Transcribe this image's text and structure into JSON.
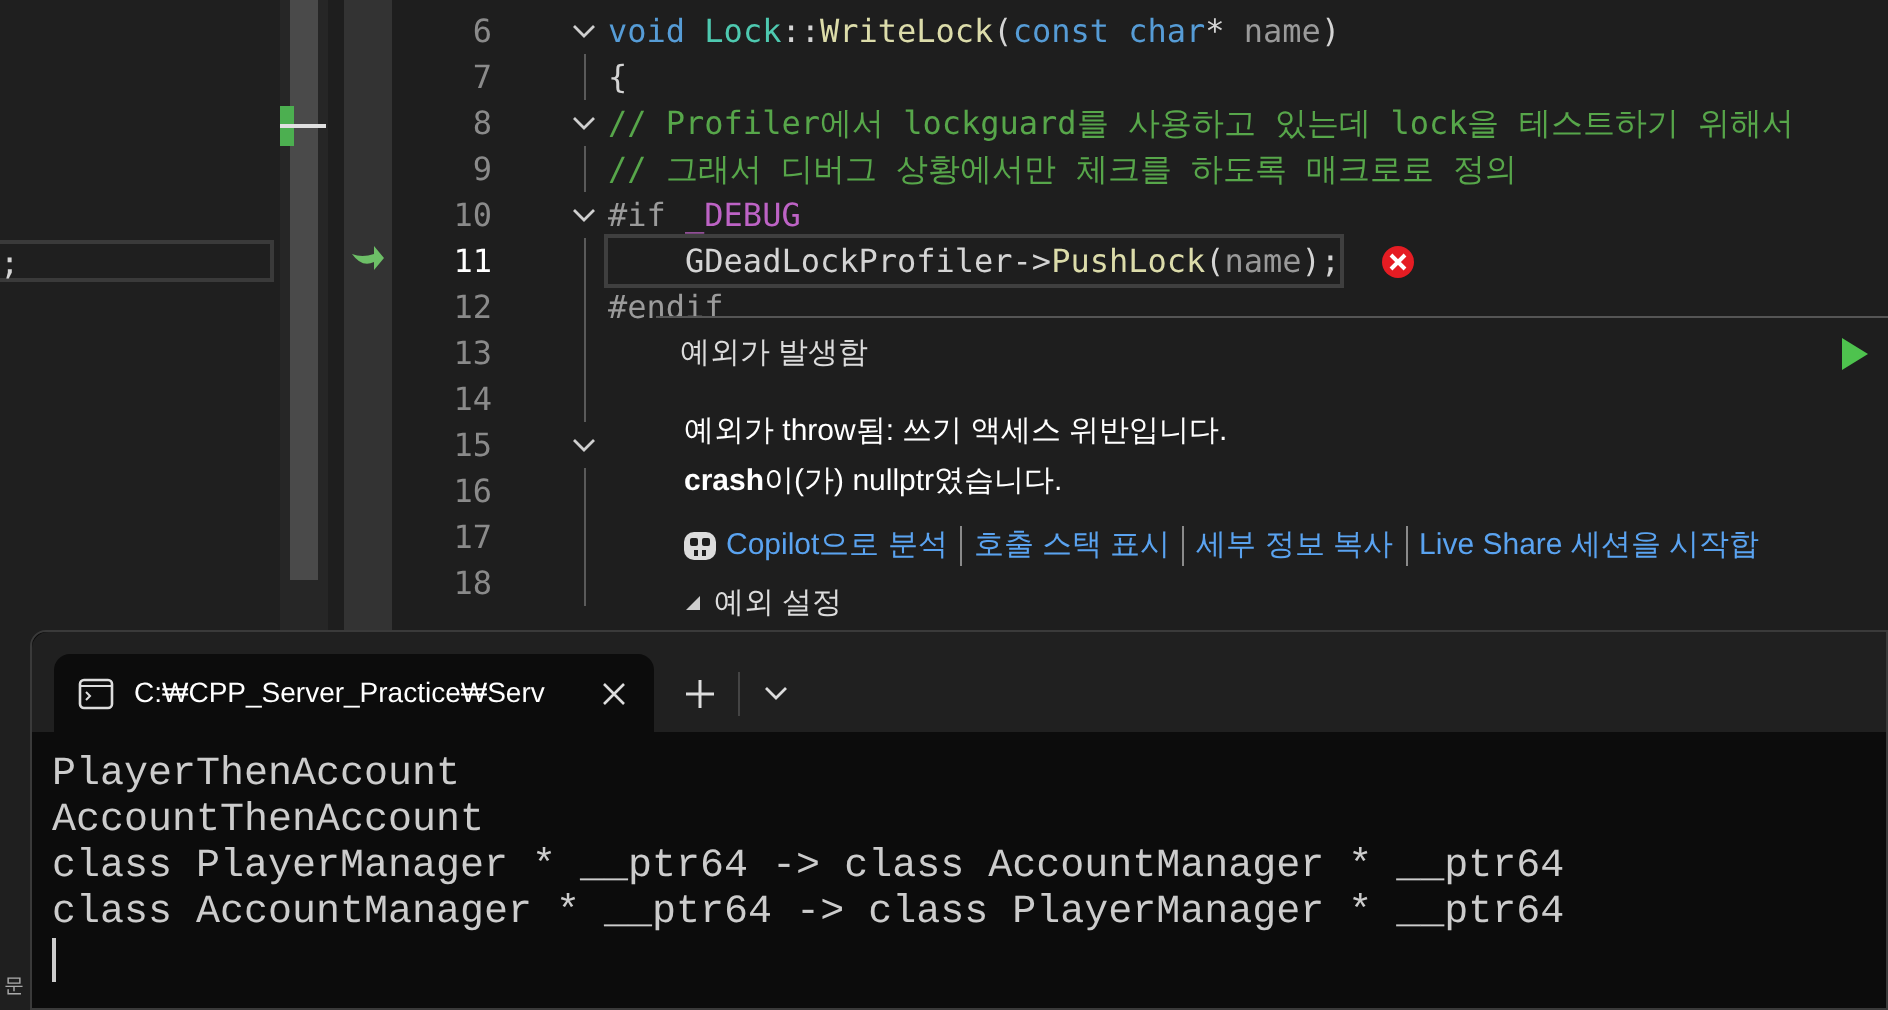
{
  "left_panel": {
    "text": ";"
  },
  "editor": {
    "lines": [
      {
        "number": "6",
        "fold": true,
        "current": false,
        "tokens": [
          {
            "kind": "kw",
            "text": "void "
          },
          {
            "kind": "type",
            "text": "Lock"
          },
          {
            "kind": "plain",
            "text": "::"
          },
          {
            "kind": "fn",
            "text": "WriteLock"
          },
          {
            "kind": "plain",
            "text": "("
          },
          {
            "kind": "kw",
            "text": "const char"
          },
          {
            "kind": "plain",
            "text": "* "
          },
          {
            "kind": "param",
            "text": "name"
          },
          {
            "kind": "plain",
            "text": ")"
          }
        ]
      },
      {
        "number": "7",
        "fold": false,
        "current": false,
        "tokens": [
          {
            "kind": "plain",
            "text": "{"
          }
        ]
      },
      {
        "number": "8",
        "fold": true,
        "current": false,
        "tokens": [
          {
            "kind": "comment",
            "text": "// Profiler에서 lockguard를 사용하고 있는데 lock을 테스트하기 위해서"
          }
        ]
      },
      {
        "number": "9",
        "fold": false,
        "current": false,
        "tokens": [
          {
            "kind": "comment",
            "text": "// 그래서 디버그 상황에서만 체크를 하도록 매크로로 정의"
          }
        ]
      },
      {
        "number": "10",
        "fold": true,
        "current": false,
        "tokens": [
          {
            "kind": "pre",
            "text": "#if "
          },
          {
            "kind": "macro",
            "text": "_DEBUG"
          }
        ]
      },
      {
        "number": "11",
        "fold": false,
        "current": true,
        "error": true,
        "tokens": [
          {
            "kind": "plain",
            "text": "    GDeadLockProfiler->"
          },
          {
            "kind": "fn",
            "text": "PushLock"
          },
          {
            "kind": "plain",
            "text": "("
          },
          {
            "kind": "param",
            "text": "name"
          },
          {
            "kind": "plain",
            "text": ");"
          }
        ]
      },
      {
        "number": "12",
        "fold": false,
        "current": false,
        "tokens": [
          {
            "kind": "pre",
            "text": "#endif"
          }
        ]
      },
      {
        "number": "13",
        "fold": false,
        "current": false
      },
      {
        "number": "14",
        "fold": false,
        "current": false
      },
      {
        "number": "15",
        "fold": true,
        "current": false
      },
      {
        "number": "16",
        "fold": false,
        "current": false
      },
      {
        "number": "17",
        "fold": false,
        "current": false
      },
      {
        "number": "18",
        "fold": false,
        "current": false
      }
    ]
  },
  "exception": {
    "title": "예외가 발생함",
    "message": "예외가 throw됨: 쓰기 액세스 위반입니다.",
    "detail": "**crash**이(가) nullptr였습니다.",
    "links": [
      {
        "kind": "copilot",
        "label": "Copilot으로 분석"
      },
      {
        "kind": "plain",
        "label": "호출 스택 표시"
      },
      {
        "kind": "plain",
        "label": "세부 정보 복사"
      },
      {
        "kind": "plain",
        "label": "Live Share 세션을 시작합"
      }
    ],
    "settings": {
      "label": "예외 설정",
      "expanded": false
    }
  },
  "terminal": {
    "tabs": [
      {
        "title": "C:₩CPP_Server_Practice₩Serv",
        "selected": true
      }
    ],
    "output": [
      "PlayerThenAccount",
      "AccountThenAccount",
      "class PlayerManager * __ptr64 -> class AccountManager * __ptr64",
      "class AccountManager * __ptr64 -> class PlayerManager * __ptr64"
    ]
  },
  "side_label": "문"
}
